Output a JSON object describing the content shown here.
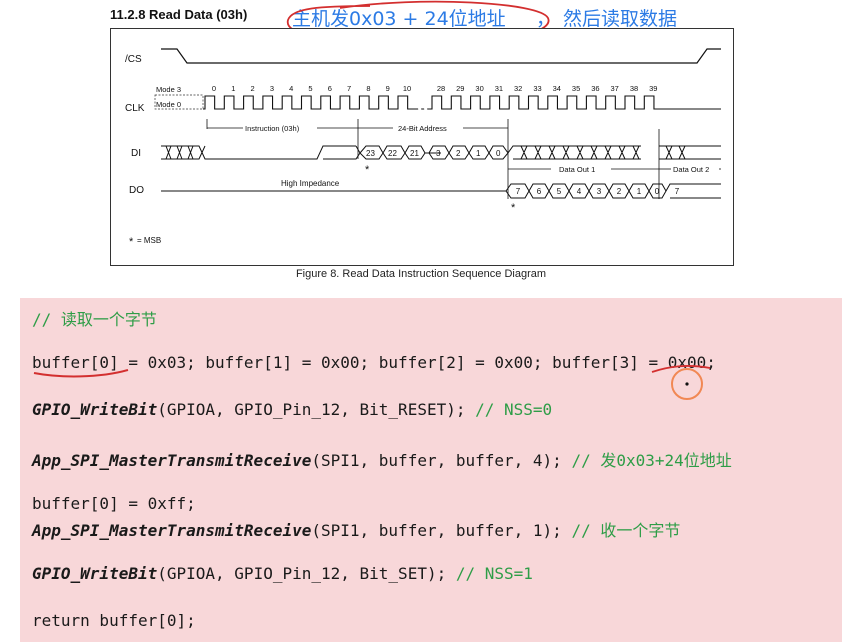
{
  "section_title": "11.2.8 Read Data (03h)",
  "annotation": {
    "main": "主机发0x03 + 24位地址",
    "sep": "，",
    "tail": "然后读取数据"
  },
  "diagram": {
    "signals": [
      "/CS",
      "CLK",
      "DI",
      "DO"
    ],
    "mode3": "Mode 3",
    "mode0": "Mode 0",
    "clock_numbers_left": [
      "0",
      "1",
      "2",
      "3",
      "4",
      "5",
      "6",
      "7",
      "8",
      "9",
      "10"
    ],
    "clock_numbers_right": [
      "28",
      "29",
      "30",
      "31",
      "32",
      "33",
      "34",
      "35",
      "36",
      "37",
      "38",
      "39"
    ],
    "instruction_label": "Instruction (03h)",
    "address_label": "24-Bit Address",
    "di_bits_left": [
      "23",
      "22",
      "21"
    ],
    "di_bits_right": [
      "3",
      "2",
      "1",
      "0"
    ],
    "do_bits": [
      "7",
      "6",
      "5",
      "4",
      "3",
      "2",
      "1",
      "0",
      "7"
    ],
    "high_impedance": "High Impedance",
    "data_out_1": "Data Out 1",
    "data_out_2": "Data Out 2",
    "msb_note": "= MSB",
    "star": "*"
  },
  "caption": "Figure 8. Read Data Instruction Sequence Diagram",
  "code": {
    "comment_read": "// 读取一个字节",
    "line_buffer_init": "buffer[0] = 0x03; buffer[1] = 0x00; buffer[2] = 0x00; buffer[3] = 0x00;",
    "gpio_reset_fn": "GPIO_WriteBit",
    "gpio_reset_args": "(GPIOA, GPIO_Pin_12, Bit_RESET); ",
    "gpio_reset_cmt": "// NSS=0",
    "spi1_fn": "App_SPI_MasterTransmitReceive",
    "spi1_args": "(SPI1, buffer, buffer, 4); ",
    "spi1_cmt": "// 发0x03+24位地址",
    "line_buffer_ff": "buffer[0] = 0xff;",
    "spi2_fn": "App_SPI_MasterTransmitReceive",
    "spi2_args": "(SPI1, buffer, buffer, 1); ",
    "spi2_cmt": "// 收一个字节",
    "gpio_set_fn": "GPIO_WriteBit",
    "gpio_set_args": "(GPIOA, GPIO_Pin_12, Bit_SET); ",
    "gpio_set_cmt": "// NSS=1",
    "line_return": "return buffer[0];"
  },
  "colors": {
    "annotation_blue": "#2c7be5",
    "highlight_red": "#d32f2f",
    "comment_green": "#2e9d47",
    "code_bg": "#f8d7d9"
  }
}
